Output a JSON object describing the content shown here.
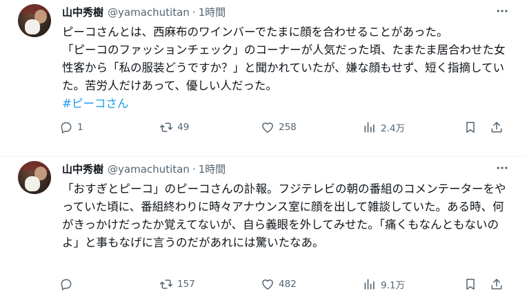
{
  "tweets": [
    {
      "name": "山中秀樹",
      "handle": "@yamachutitan",
      "dot": "·",
      "time": "1時間",
      "text": "ピーコさんとは、西麻布のワインバーでたまに顔を合わせることがあった。\n「ピーコのファッションチェック」のコーナーが人気だった頃、たまたま居合わせた女性客から「私の服装どうですか？」と聞かれていたが、嫌な顔もせず、短く指摘していた。苦労人だけあって、優しい人だった。",
      "hashtag": "#ピーコさん",
      "replies": "1",
      "retweets": "49",
      "likes": "258",
      "views": "2.4万"
    },
    {
      "name": "山中秀樹",
      "handle": "@yamachutitan",
      "dot": "·",
      "time": "1時間",
      "text": "「おすぎとピーコ」のピーコさんの訃報。フジテレビの朝の番組のコメンテーターをやっていた頃に、番組終わりに時々アナウンス室に顔を出して雑談していた。ある時、何がきっかけだったか覚えてないが、自ら義眼を外してみせた。「痛くもなんともないのよ」と事もなげに言うのだがあれには驚いたなあ。",
      "hashtag": "",
      "replies": "",
      "retweets": "157",
      "likes": "482",
      "views": "9.1万"
    }
  ]
}
